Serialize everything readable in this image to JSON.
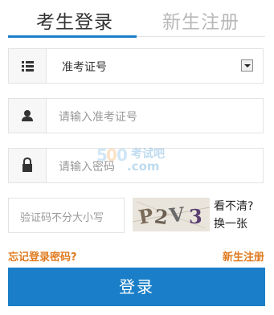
{
  "tabs": {
    "login": "考生登录",
    "new_student": "新生注册"
  },
  "exam_id_type": {
    "selected": "准考证号"
  },
  "exam_id_input": {
    "placeholder": "请输入准考证号"
  },
  "password_input": {
    "placeholder": "请输入密码"
  },
  "captcha": {
    "placeholder": "验证码不分大小写",
    "image_text": "P2V3",
    "refresh_line1": "看不清?",
    "refresh_line2": "换一张"
  },
  "links": {
    "forgot_password": "忘记登录密码?",
    "register": "新生注册"
  },
  "login_button": "登录",
  "watermark": {
    "text": "考试吧",
    "domain": ".com"
  },
  "colors": {
    "accent": "#1a7fc8",
    "link": "#e07a1f"
  }
}
